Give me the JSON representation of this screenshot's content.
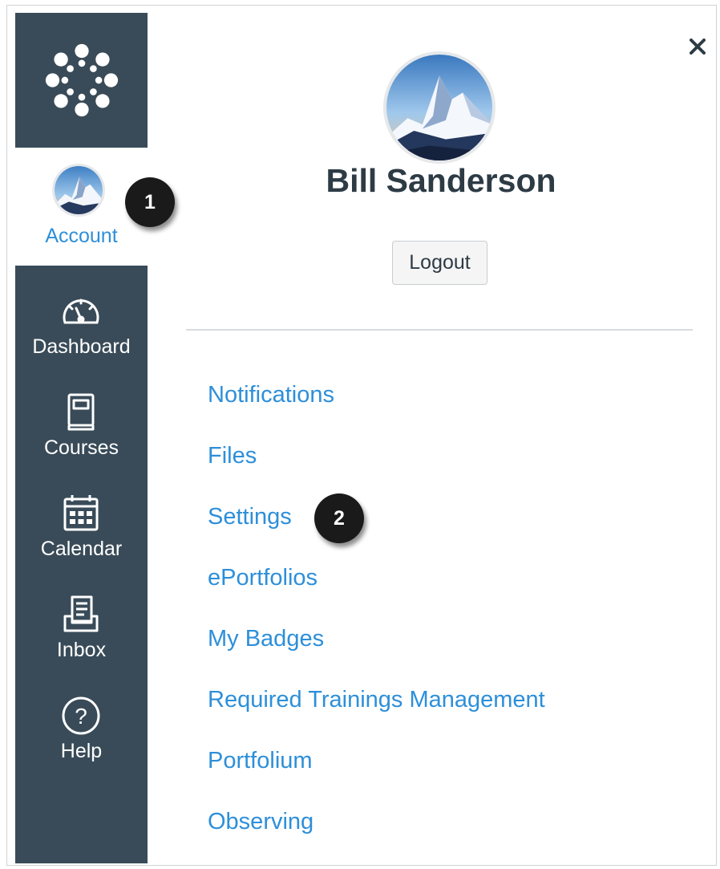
{
  "nav": {
    "account_label": "Account",
    "items": [
      {
        "label": "Dashboard",
        "icon": "dashboard-gauge-icon"
      },
      {
        "label": "Courses",
        "icon": "book-icon"
      },
      {
        "label": "Calendar",
        "icon": "calendar-icon"
      },
      {
        "label": "Inbox",
        "icon": "inbox-tray-icon"
      },
      {
        "label": "Help",
        "icon": "question-circle-icon"
      }
    ]
  },
  "tray": {
    "user_name": "Bill Sanderson",
    "logout_label": "Logout",
    "links": [
      "Notifications",
      "Files",
      "Settings",
      "ePortfolios",
      "My Badges",
      "Required Trainings Management",
      "Portfolium",
      "Observing"
    ]
  },
  "callouts": {
    "first": "1",
    "second": "2"
  },
  "colors": {
    "nav_background": "#394b58",
    "link": "#2d8fd9",
    "text_dark": "#2d3b45",
    "callout": "#1a1a1a"
  }
}
